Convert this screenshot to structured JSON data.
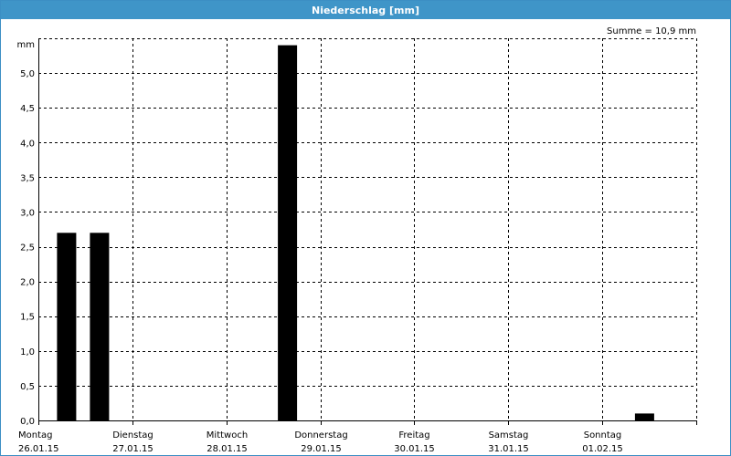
{
  "window": {
    "title": "Niederschlag [mm]"
  },
  "chart_data": {
    "type": "bar",
    "title": "Niederschlag [mm]",
    "annotation": "Summe = 10,9 mm",
    "ylabel": "mm",
    "ylim": [
      0,
      5.5
    ],
    "yticks": [
      0,
      0.5,
      1.0,
      1.5,
      2.0,
      2.5,
      3.0,
      3.5,
      4.0,
      4.5,
      5.0
    ],
    "ytick_labels": [
      "0,0",
      "0,5",
      "1,0",
      "1,5",
      "2,0",
      "2,5",
      "3,0",
      "3,5",
      "4,0",
      "4,5",
      "5,0"
    ],
    "x_days": [
      {
        "day": "Montag",
        "date": "26.01.15"
      },
      {
        "day": "Dienstag",
        "date": "27.01.15"
      },
      {
        "day": "Mittwoch",
        "date": "28.01.15"
      },
      {
        "day": "Donnerstag",
        "date": "29.01.15"
      },
      {
        "day": "Freitag",
        "date": "30.01.15"
      },
      {
        "day": "Samstag",
        "date": "31.01.15"
      },
      {
        "day": "Sonntag",
        "date": "01.02.15"
      }
    ],
    "bars": [
      {
        "day_index": 0.3,
        "value": 2.7
      },
      {
        "day_index": 0.65,
        "value": 2.7
      },
      {
        "day_index": 2.65,
        "value": 5.4
      },
      {
        "day_index": 6.45,
        "value": 0.1
      }
    ],
    "grid": true,
    "grid_style": "dashed",
    "bar_color": "#000000"
  }
}
